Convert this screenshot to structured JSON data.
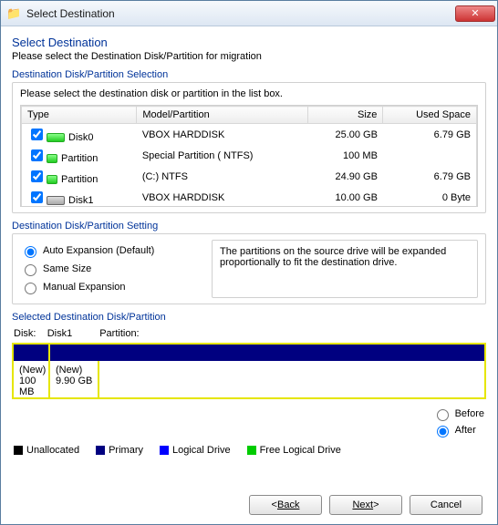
{
  "window": {
    "title": "Select Destination"
  },
  "header": {
    "title": "Select Destination",
    "subtitle": "Please select the Destination Disk/Partition for migration"
  },
  "selection": {
    "group_label": "Destination Disk/Partition Selection",
    "instruction": "Please select the destination disk or partition in the list box.",
    "columns": {
      "type": "Type",
      "model": "Model/Partition",
      "size": "Size",
      "used": "Used Space"
    },
    "rows": [
      {
        "type": "Disk0",
        "model": "VBOX HARDDISK",
        "size": "25.00 GB",
        "used": "6.79 GB",
        "icon": "green"
      },
      {
        "type": "Partition",
        "model": "Special Partition ( NTFS)",
        "size": "100 MB",
        "used": "",
        "icon": "green small"
      },
      {
        "type": "Partition",
        "model": "(C:)  NTFS",
        "size": "24.90 GB",
        "used": "6.79 GB",
        "icon": "green small"
      },
      {
        "type": "Disk1",
        "model": "VBOX HARDDISK",
        "size": "10.00 GB",
        "used": "0 Byte",
        "icon": "gray"
      }
    ]
  },
  "setting": {
    "group_label": "Destination Disk/Partition Setting",
    "options": {
      "auto": "Auto Expansion (Default)",
      "same": "Same Size",
      "manual": "Manual Expansion"
    },
    "selected": "auto",
    "description": "The partitions on the source drive will be expanded proportionally to fit the destination drive."
  },
  "selected": {
    "group_label": "Selected Destination Disk/Partition",
    "disk_label": "Disk:",
    "disk_value": "Disk1",
    "partition_label": "Partition:",
    "cells": [
      {
        "line1": "(New)",
        "line2": "100 MB"
      },
      {
        "line1": "(New)",
        "line2": "9.90 GB"
      }
    ]
  },
  "order": {
    "before": "Before",
    "after": "After",
    "selected": "after"
  },
  "legend": {
    "unallocated": "Unallocated",
    "primary": "Primary",
    "logical": "Logical Drive",
    "free": "Free Logical Drive",
    "colors": {
      "unallocated": "#000000",
      "primary": "#000080",
      "logical": "#0000ff",
      "free": "#00cc00"
    }
  },
  "buttons": {
    "back": "Back",
    "next": "Next",
    "cancel": "Cancel"
  }
}
